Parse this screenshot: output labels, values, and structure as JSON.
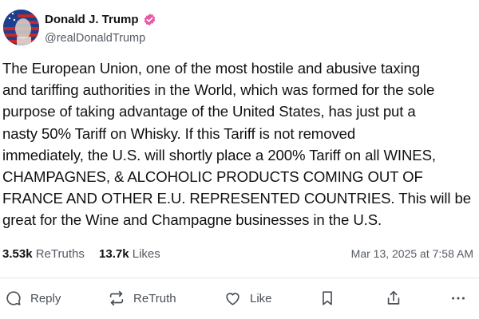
{
  "author": {
    "display_name": "Donald J. Trump",
    "handle": "@realDonaldTrump",
    "verified": true,
    "avatar": "avatar-flag-portrait"
  },
  "post": {
    "lines": [
      "The European Union, one of the most hostile and abusive taxing",
      "and tariffing authorities in the World, which was formed for the sole",
      "purpose of taking advantage of the United States, has just put a",
      "nasty 50% Tariff on Whisky. If this Tariff is not removed",
      "immediately, the U.S. will shortly place a 200% Tariff on all WINES,",
      "CHAMPAGNES, & ALCOHOLIC PRODUCTS COMING OUT OF",
      "FRANCE AND OTHER E.U. REPRESENTED COUNTRIES. This will be",
      "great for the Wine and Champagne businesses in the U.S."
    ]
  },
  "stats": {
    "retruths_count": "3.53k",
    "retruths_label": "ReTruths",
    "likes_count": "13.7k",
    "likes_label": "Likes",
    "timestamp": "Mar 13, 2025 at 7:58 AM"
  },
  "actions": {
    "reply": "Reply",
    "retruth": "ReTruth",
    "like": "Like"
  },
  "icons": [
    "reply-icon",
    "retruth-icon",
    "like-icon",
    "bookmark-icon",
    "share-icon",
    "more-icon",
    "verified-icon"
  ],
  "colors": {
    "accent": "#e75aa6",
    "muted": "#555a63",
    "text": "#111111",
    "divider": "#e6e6ea"
  }
}
